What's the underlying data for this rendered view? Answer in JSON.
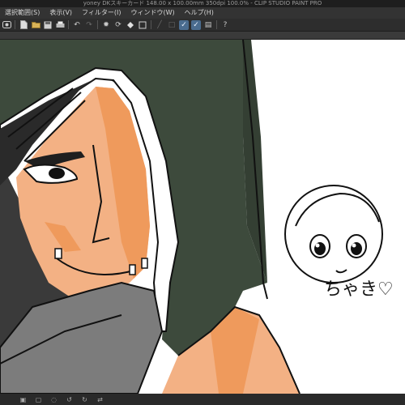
{
  "window": {
    "title": "yoney DKスキーカード 148.00 x 100.00mm 350dpi 100.0% - CLIP STUDIO PAINT PRO"
  },
  "menu": {
    "items": [
      "選択範囲(S)",
      "表示(V)",
      "フィルター(I)",
      "ウィンドウ(W)",
      "ヘルプ(H)"
    ]
  },
  "toolbar": {
    "icons": [
      "app-icon",
      "new-icon",
      "open-icon",
      "save-icon",
      "print-icon",
      "undo-icon",
      "redo-icon",
      "sun-icon",
      "rotate-icon",
      "fill-icon",
      "clear-icon",
      "pen-icon",
      "line-icon",
      "shape-icon",
      "snap-icon",
      "ruler-icon",
      "help-icon"
    ]
  },
  "canvas": {
    "handwritten_text": "ちゃき♡",
    "palette": {
      "hood_green": "#3d4a3c",
      "skin": "#f3b184",
      "skin_shadow": "#ef9a5c",
      "hair_dark": "#2a2a2a",
      "gray_cloth": "#7c7c7c",
      "background": "#ffffff"
    }
  }
}
